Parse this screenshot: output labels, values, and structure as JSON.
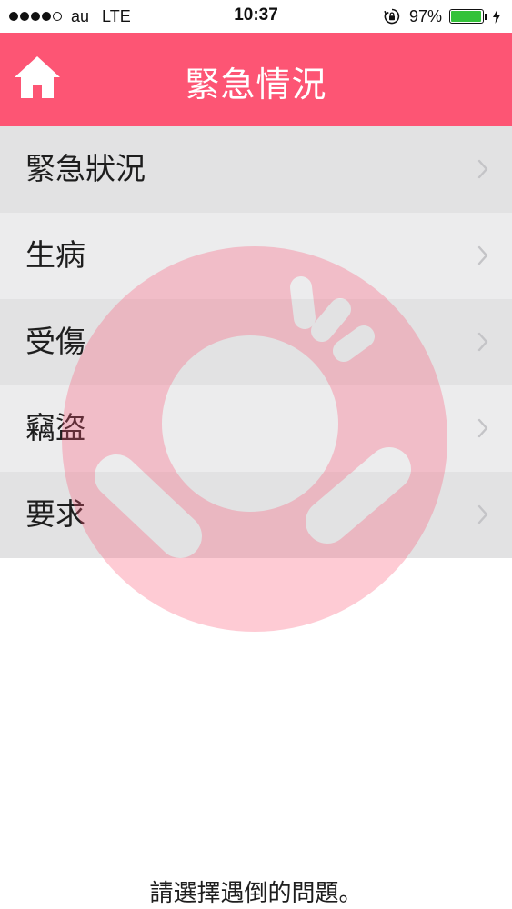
{
  "status_bar": {
    "carrier": "au",
    "network": "LTE",
    "time": "10:37",
    "battery_percent": "97%",
    "battery_level": 0.97,
    "signal_bars_filled": 4,
    "signal_bars_total": 5,
    "icons": [
      "orientation-lock-icon",
      "battery-icon",
      "charging-bolt-icon"
    ]
  },
  "header": {
    "title": "緊急情況",
    "home_icon": "home-icon",
    "background_color": "#fd5574"
  },
  "menu": {
    "items": [
      {
        "label": "緊急狀況"
      },
      {
        "label": "生病"
      },
      {
        "label": "受傷"
      },
      {
        "label": "竊盜"
      },
      {
        "label": "要求"
      }
    ],
    "chevron_icon": "chevron-right-icon"
  },
  "watermark": {
    "icon": "alert-ring-icon",
    "color": "#fd5574"
  },
  "footer": {
    "hint": "請選擇遇倒的問題。"
  }
}
